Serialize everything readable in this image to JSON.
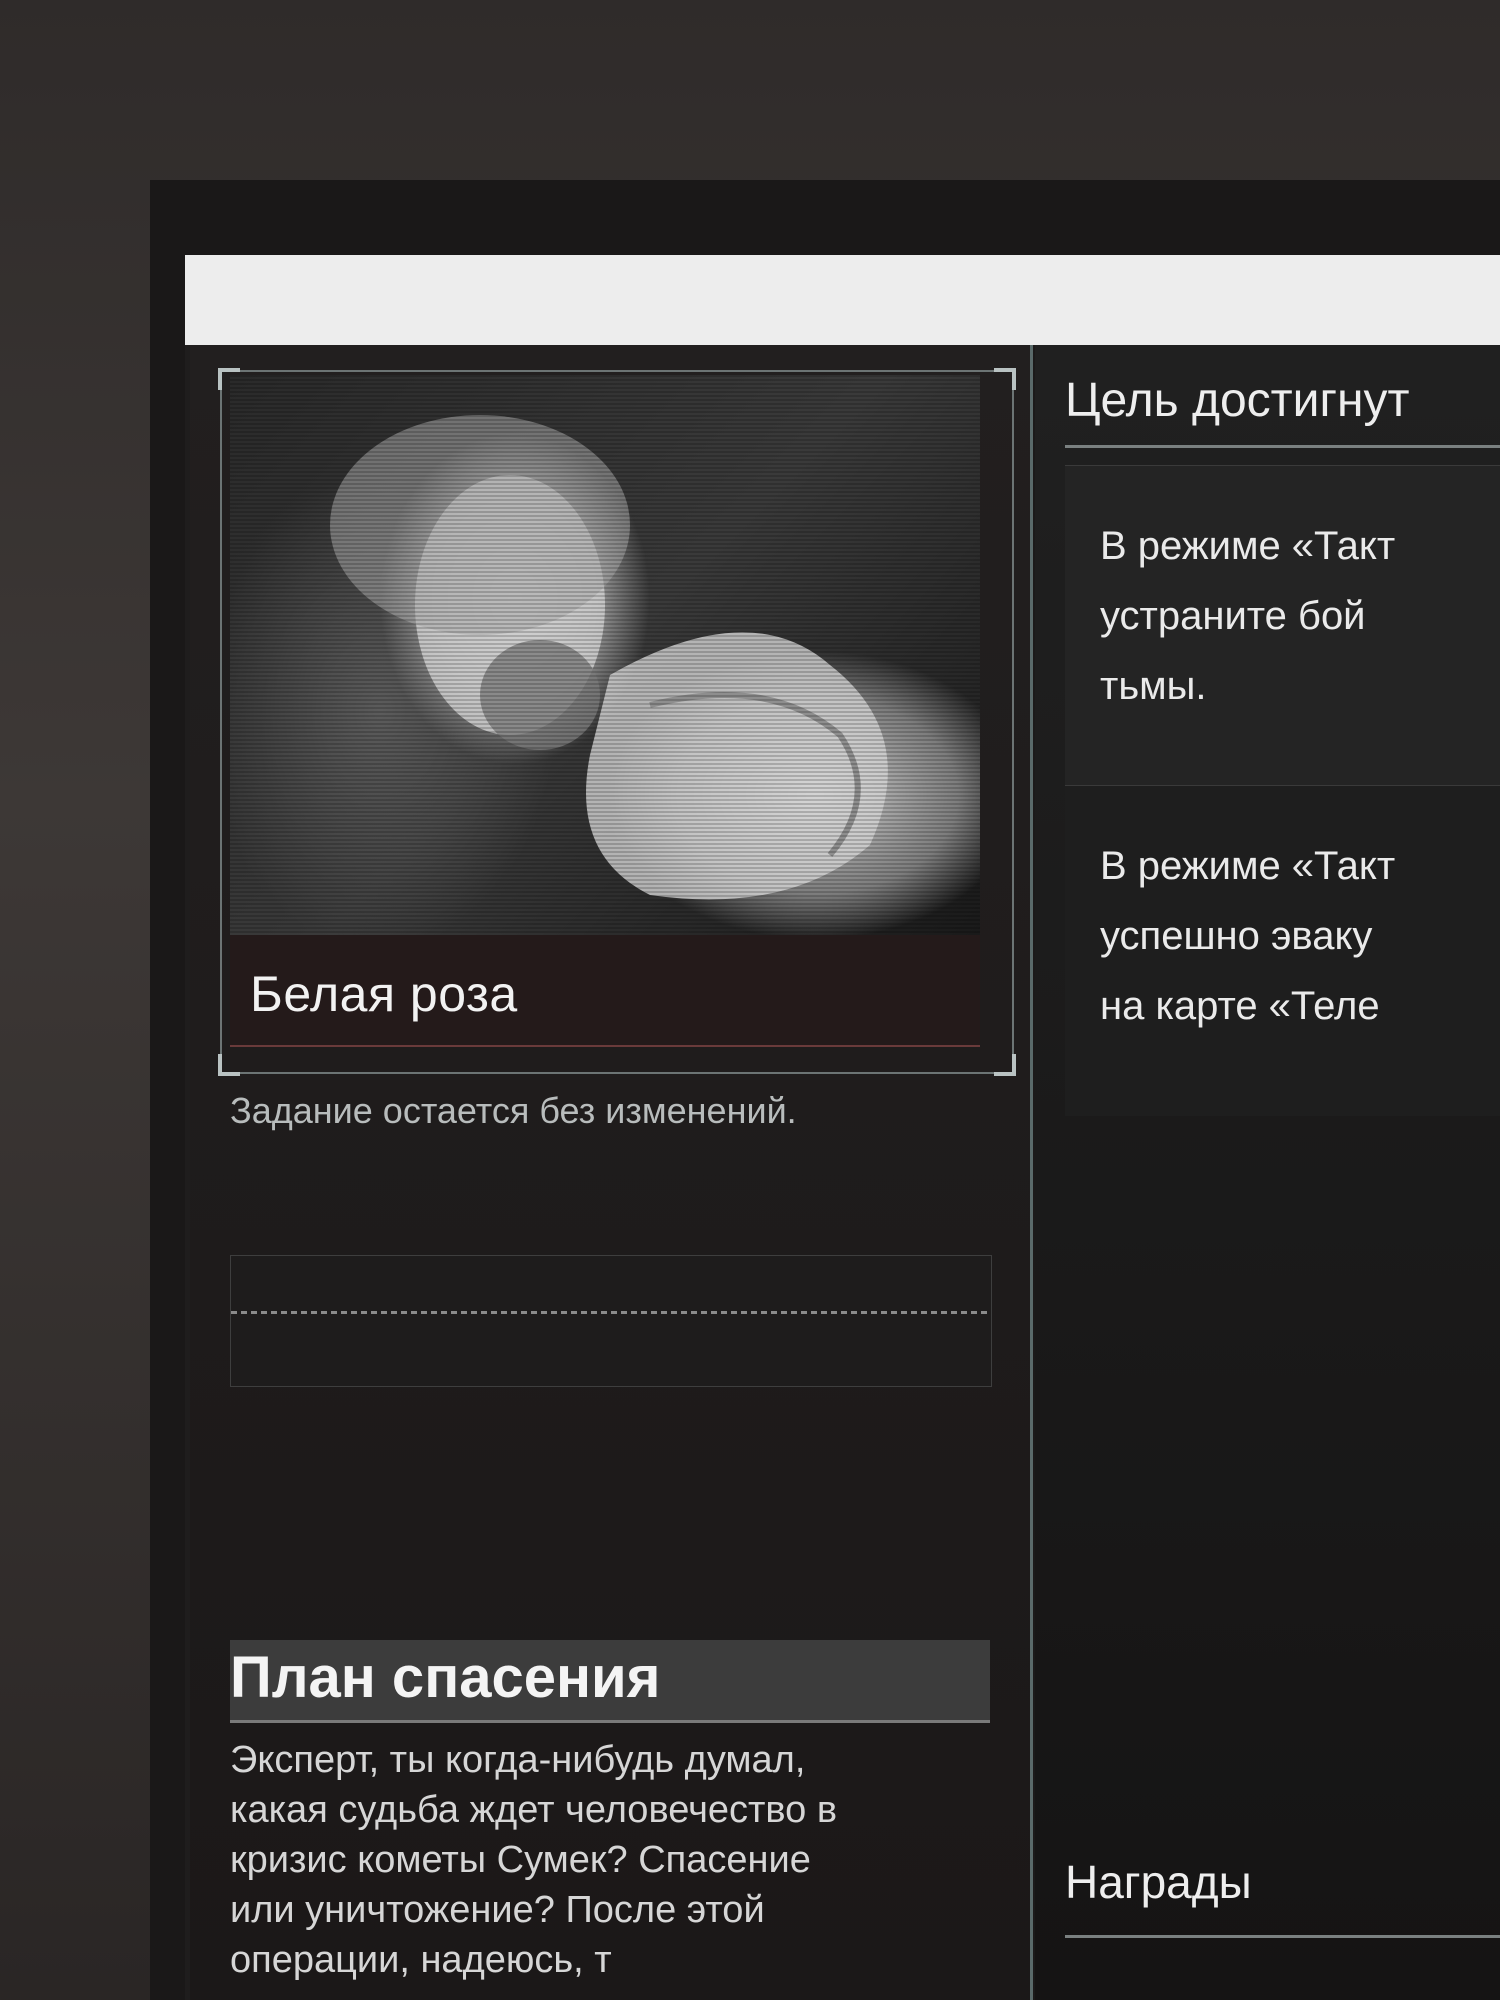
{
  "quest_card": {
    "title": "Белая роза",
    "image_icon": "portrait-image"
  },
  "status": {
    "text": "Задание остается без изменений."
  },
  "plan": {
    "title": "План спасения",
    "lines": [
      "Эксперт, ты когда-нибудь думал,",
      "какая судьба ждет человечество в",
      "кризис кометы Сумек? Спасение",
      "или уничтожение? После этой",
      "операции, надеюсь, т"
    ]
  },
  "goal": {
    "title": "Цель достигнут",
    "objectives": [
      {
        "lines": [
          "В режиме «Такт",
          "устраните бой",
          "тьмы."
        ]
      },
      {
        "lines": [
          "В режиме «Такт",
          "успешно эваку",
          "на карте «Теле"
        ]
      }
    ]
  },
  "rewards": {
    "title": "Награды"
  },
  "colors": {
    "background": "#1c1a1a",
    "accent_border": "#6c7474",
    "caption_bg": "#241a1a"
  }
}
